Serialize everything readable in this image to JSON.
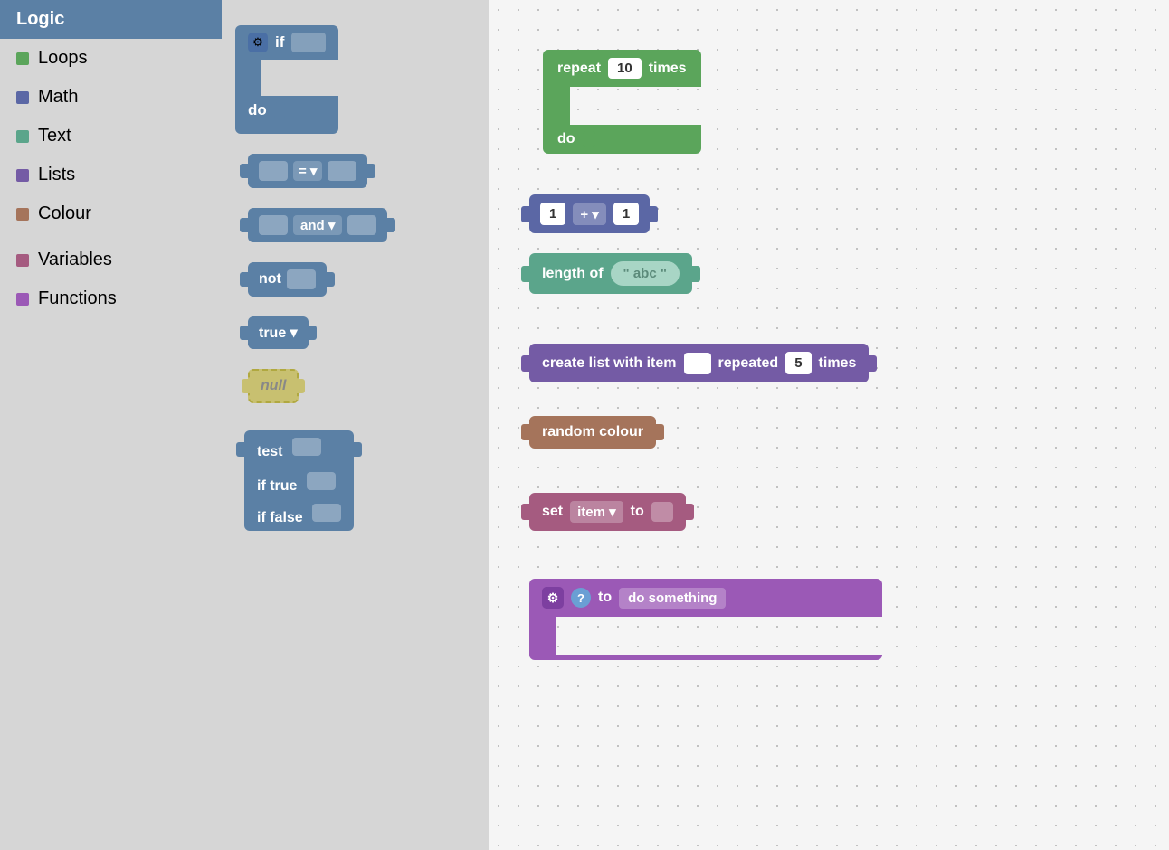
{
  "sidebar": {
    "items": [
      {
        "id": "logic",
        "label": "Logic",
        "color": "#5b80a5",
        "active": true
      },
      {
        "id": "loops",
        "label": "Loops",
        "color": "#5ba55b"
      },
      {
        "id": "math",
        "label": "Math",
        "color": "#5b67a5"
      },
      {
        "id": "text",
        "label": "Text",
        "color": "#5ba58b"
      },
      {
        "id": "lists",
        "label": "Lists",
        "color": "#745ba5"
      },
      {
        "id": "colour",
        "label": "Colour",
        "color": "#a5745b"
      },
      {
        "id": "variables",
        "label": "Variables",
        "color": "#a55b80"
      },
      {
        "id": "functions",
        "label": "Functions",
        "color": "#9b59b6"
      }
    ]
  },
  "blocks_panel": {
    "if_block": {
      "label": "if",
      "do_label": "do"
    },
    "equals_block": {
      "operator": "="
    },
    "and_block": {
      "operator": "and"
    },
    "not_block": {
      "label": "not"
    },
    "true_block": {
      "label": "true"
    },
    "null_block": {
      "label": "null"
    },
    "ternary_block": {
      "test_label": "test",
      "iftrue_label": "if true",
      "iffalse_label": "if false"
    }
  },
  "canvas_blocks": {
    "repeat_block": {
      "label": "repeat",
      "value": "10",
      "times_label": "times",
      "do_label": "do"
    },
    "math_block": {
      "left": "1",
      "operator": "+",
      "right": "1"
    },
    "length_block": {
      "label": "length of",
      "value": "abc"
    },
    "list_block": {
      "label": "create list with item",
      "repeated_label": "repeated",
      "value": "5",
      "times_label": "times"
    },
    "colour_block": {
      "label": "random colour"
    },
    "variable_block": {
      "set_label": "set",
      "var_name": "item",
      "to_label": "to"
    },
    "function_block": {
      "to_label": "to",
      "name": "do something"
    }
  },
  "colors": {
    "logic": "#5b80a5",
    "loops": "#5ba55b",
    "math": "#5b67a5",
    "text": "#5ba58b",
    "lists": "#745ba5",
    "colour": "#a5745b",
    "variables": "#a55b80",
    "functions": "#9b59b6",
    "sidebar_bg": "#d6d6d6",
    "canvas_bg": "#f5f5f5"
  }
}
